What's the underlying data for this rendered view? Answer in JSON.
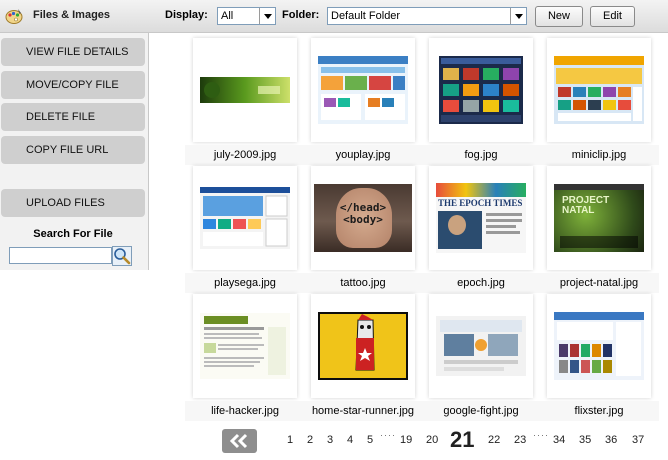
{
  "header": {
    "title": "Files & Images",
    "display_label": "Display:",
    "display_value": "All",
    "folder_label": "Folder:",
    "folder_value": "Default Folder",
    "new_label": "New",
    "edit_label": "Edit"
  },
  "sidebar": {
    "actions": [
      "VIEW FILE DETAILS",
      "MOVE/COPY FILE",
      "DELETE FILE",
      "COPY FILE URL"
    ],
    "upload_label": "UPLOAD FILES",
    "search_label": "Search For File",
    "search_value": ""
  },
  "files": [
    {
      "name": "july-2009.jpg"
    },
    {
      "name": "youplay.jpg"
    },
    {
      "name": "fog.jpg"
    },
    {
      "name": "miniclip.jpg"
    },
    {
      "name": "playsega.jpg"
    },
    {
      "name": "tattoo.jpg",
      "thumb_text": "</head>\n<body>"
    },
    {
      "name": "epoch.jpg",
      "thumb_text": "THE EPOCH TIMES"
    },
    {
      "name": "project-natal.jpg",
      "thumb_text": "PROJECT NATAL"
    },
    {
      "name": "life-hacker.jpg"
    },
    {
      "name": "home-star-runner.jpg"
    },
    {
      "name": "google-fight.jpg"
    },
    {
      "name": "flixster.jpg"
    }
  ],
  "pagination": {
    "pages_before": [
      "1",
      "2",
      "3",
      "4",
      "5"
    ],
    "ellipsis": "····",
    "pages_middle": [
      "19",
      "20"
    ],
    "current": "21",
    "pages_after_current": [
      "22",
      "23"
    ],
    "pages_end": [
      "34",
      "35",
      "36",
      "37"
    ]
  },
  "colors": {
    "header_bg": "#e6e6e6",
    "sidebar_bg": "#f2f2f2",
    "sidebar_button": "#cfcfcf",
    "filename_bg": "#f7f7f7",
    "prev_button": "#8e8e8e"
  },
  "icons": {
    "app": "palette-icon",
    "search": "magnifier-icon",
    "prev": "double-chevron-left-icon"
  }
}
